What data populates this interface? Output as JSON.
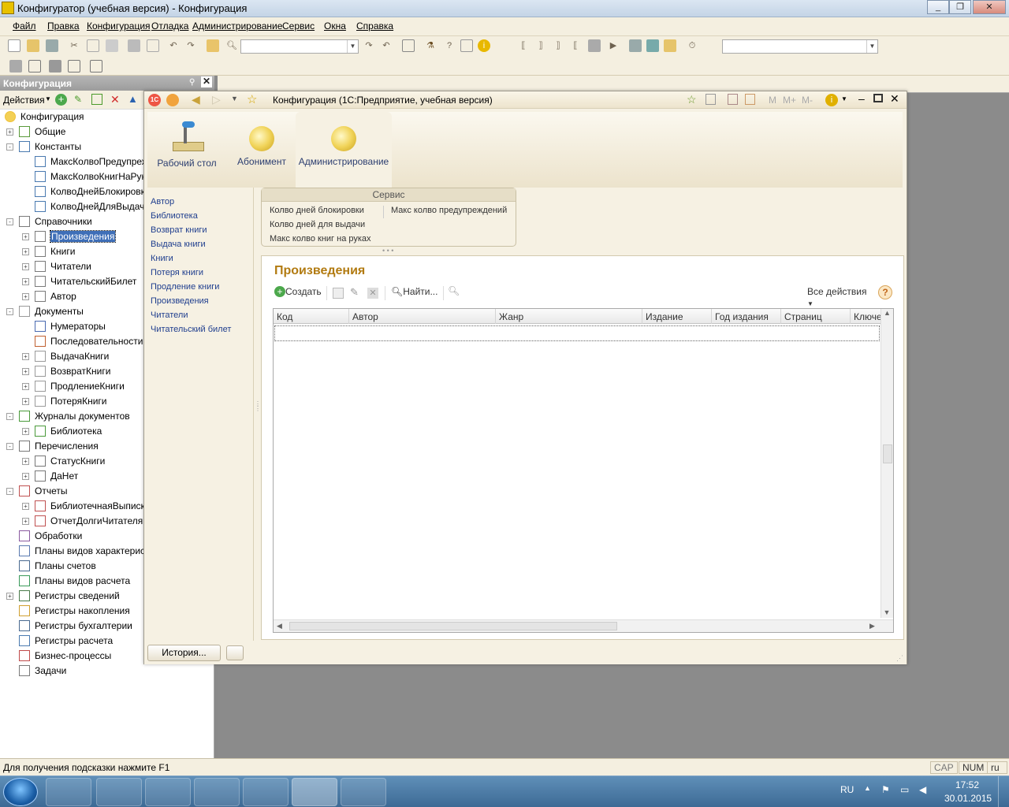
{
  "window": {
    "title": "Конфигуратор (учебная версия) - Конфигурация",
    "controls": [
      "_",
      "❐",
      "✕"
    ]
  },
  "menu": [
    "Файл",
    "Правка",
    "Конфигурация",
    "Отладка",
    "Администрирование",
    "Сервис",
    "Окна",
    "Справка"
  ],
  "config_panel": {
    "title": "Конфигурация",
    "actions_label": "Действия",
    "tree": [
      {
        "level": 0,
        "pm": "",
        "label": "Конфигурация",
        "icon": "config-root-icon"
      },
      {
        "level": 1,
        "pm": "+",
        "label": "Общие",
        "icon": "common-icon"
      },
      {
        "level": 1,
        "pm": "-",
        "label": "Константы",
        "icon": "constants-icon"
      },
      {
        "level": 2,
        "pm": "",
        "label": "МаксКолвоПредупреж...",
        "icon": "constant-icon"
      },
      {
        "level": 2,
        "pm": "",
        "label": "МаксКолвоКнигНаРуках",
        "icon": "constant-icon"
      },
      {
        "level": 2,
        "pm": "",
        "label": "КолвоДнейБлокировки",
        "icon": "constant-icon"
      },
      {
        "level": 2,
        "pm": "",
        "label": "КолвоДнейДляВыдачи",
        "icon": "constant-icon"
      },
      {
        "level": 1,
        "pm": "-",
        "label": "Справочники",
        "icon": "catalogs-icon"
      },
      {
        "level": 2,
        "pm": "+",
        "label": "Произведения",
        "icon": "catalog-icon",
        "selected": true
      },
      {
        "level": 2,
        "pm": "+",
        "label": "Книги",
        "icon": "catalog-icon"
      },
      {
        "level": 2,
        "pm": "+",
        "label": "Читатели",
        "icon": "catalog-icon"
      },
      {
        "level": 2,
        "pm": "+",
        "label": "ЧитательскийБилет",
        "icon": "catalog-icon"
      },
      {
        "level": 2,
        "pm": "+",
        "label": "Автор",
        "icon": "catalog-icon"
      },
      {
        "level": 1,
        "pm": "-",
        "label": "Документы",
        "icon": "documents-icon"
      },
      {
        "level": 2,
        "pm": "",
        "label": "Нумераторы",
        "icon": "numerators-icon"
      },
      {
        "level": 2,
        "pm": "",
        "label": "Последовательности",
        "icon": "sequences-icon"
      },
      {
        "level": 2,
        "pm": "+",
        "label": "ВыдачаКниги",
        "icon": "document-icon"
      },
      {
        "level": 2,
        "pm": "+",
        "label": "ВозвратКниги",
        "icon": "document-icon"
      },
      {
        "level": 2,
        "pm": "+",
        "label": "ПродлениеКниги",
        "icon": "document-icon"
      },
      {
        "level": 2,
        "pm": "+",
        "label": "ПотеряКниги",
        "icon": "document-icon"
      },
      {
        "level": 1,
        "pm": "-",
        "label": "Журналы документов",
        "icon": "journals-icon"
      },
      {
        "level": 2,
        "pm": "+",
        "label": "Библиотека",
        "icon": "journal-icon"
      },
      {
        "level": 1,
        "pm": "-",
        "label": "Перечисления",
        "icon": "enums-icon"
      },
      {
        "level": 2,
        "pm": "+",
        "label": "СтатусКниги",
        "icon": "enum-icon"
      },
      {
        "level": 2,
        "pm": "+",
        "label": "ДаНет",
        "icon": "enum-icon"
      },
      {
        "level": 1,
        "pm": "-",
        "label": "Отчеты",
        "icon": "reports-icon"
      },
      {
        "level": 2,
        "pm": "+",
        "label": "БиблиотечнаяВыписка",
        "icon": "report-icon"
      },
      {
        "level": 2,
        "pm": "+",
        "label": "ОтчетДолгиЧитателя",
        "icon": "report-icon"
      },
      {
        "level": 1,
        "pm": "",
        "label": "Обработки",
        "icon": "processing-icon"
      },
      {
        "level": 1,
        "pm": "",
        "label": "Планы видов характеристик",
        "icon": "chart-char-icon"
      },
      {
        "level": 1,
        "pm": "",
        "label": "Планы счетов",
        "icon": "accounts-icon"
      },
      {
        "level": 1,
        "pm": "",
        "label": "Планы видов расчета",
        "icon": "calc-types-icon"
      },
      {
        "level": 1,
        "pm": "+",
        "label": "Регистры сведений",
        "icon": "info-reg-icon"
      },
      {
        "level": 1,
        "pm": "",
        "label": "Регистры накопления",
        "icon": "accum-reg-icon"
      },
      {
        "level": 1,
        "pm": "",
        "label": "Регистры бухгалтерии",
        "icon": "acc-reg-icon"
      },
      {
        "level": 1,
        "pm": "",
        "label": "Регистры расчета",
        "icon": "calc-reg-icon"
      },
      {
        "level": 1,
        "pm": "",
        "label": "Бизнес-процессы",
        "icon": "bp-icon"
      },
      {
        "level": 1,
        "pm": "",
        "label": "Задачи",
        "icon": "tasks-icon"
      }
    ]
  },
  "app_window": {
    "title": "Конфигурация  (1С:Предприятие, учебная версия)",
    "mem_buttons": [
      "M",
      "M+",
      "M-"
    ],
    "sections": [
      {
        "label": "Рабочий стол",
        "icon": "desk-lamp-icon"
      },
      {
        "label": "Абонимент",
        "icon": "section-bulb-icon"
      },
      {
        "label": "Администрирование",
        "icon": "section-bulb-icon"
      }
    ],
    "nav": [
      "Автор",
      "Библиотека",
      "Возврат книги",
      "Выдача книги",
      "Книги",
      "Потеря книги",
      "Продление книги",
      "Произведения",
      "Читатели",
      "Читательский билет"
    ],
    "service": {
      "title": "Сервис",
      "left": [
        "Колво дней блокировки",
        "Колво дней для выдачи",
        "Макс колво книг на руках"
      ],
      "right": [
        "Макс колво предупреждений"
      ]
    },
    "form": {
      "title": "Произведения",
      "create": "Создать",
      "find": "Найти...",
      "all_actions": "Все действия",
      "help": "?",
      "columns": [
        "Код",
        "Автор",
        "Жанр",
        "Издание",
        "Год издания",
        "Страниц",
        "Ключе"
      ]
    },
    "history": "История..."
  },
  "status": {
    "hint": "Для получения подсказки нажмите F1",
    "cap": "CAP",
    "num": "NUM",
    "lang": "ru"
  },
  "taskbar": {
    "lang": "RU",
    "time": "17:52",
    "date": "30.01.2015"
  }
}
